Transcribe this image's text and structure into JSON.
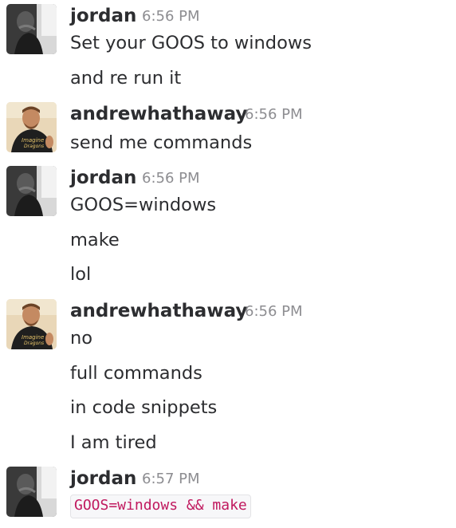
{
  "messages": [
    {
      "author": "jordan",
      "time": "6:56 PM",
      "lines": [
        "Set your GOOS to windows",
        "and re run it"
      ]
    },
    {
      "author": "andrewhathaway",
      "time": "6:56 PM",
      "lines": [
        "send me commands"
      ]
    },
    {
      "author": "jordan",
      "time": "6:56 PM",
      "lines": [
        "GOOS=windows",
        "make",
        "lol"
      ]
    },
    {
      "author": "andrewhathaway",
      "time": "6:56 PM",
      "lines": [
        "no",
        "full commands",
        "in code snippets",
        "I am tired"
      ]
    },
    {
      "author": "jordan",
      "time": "6:57 PM",
      "code": "GOOS=windows && make"
    }
  ],
  "colors": {
    "text": "#2c2d30",
    "timestamp": "#8d8d91",
    "code_text": "#c0185e",
    "code_bg": "#f7f7f9",
    "code_border": "#e3e3e6"
  }
}
